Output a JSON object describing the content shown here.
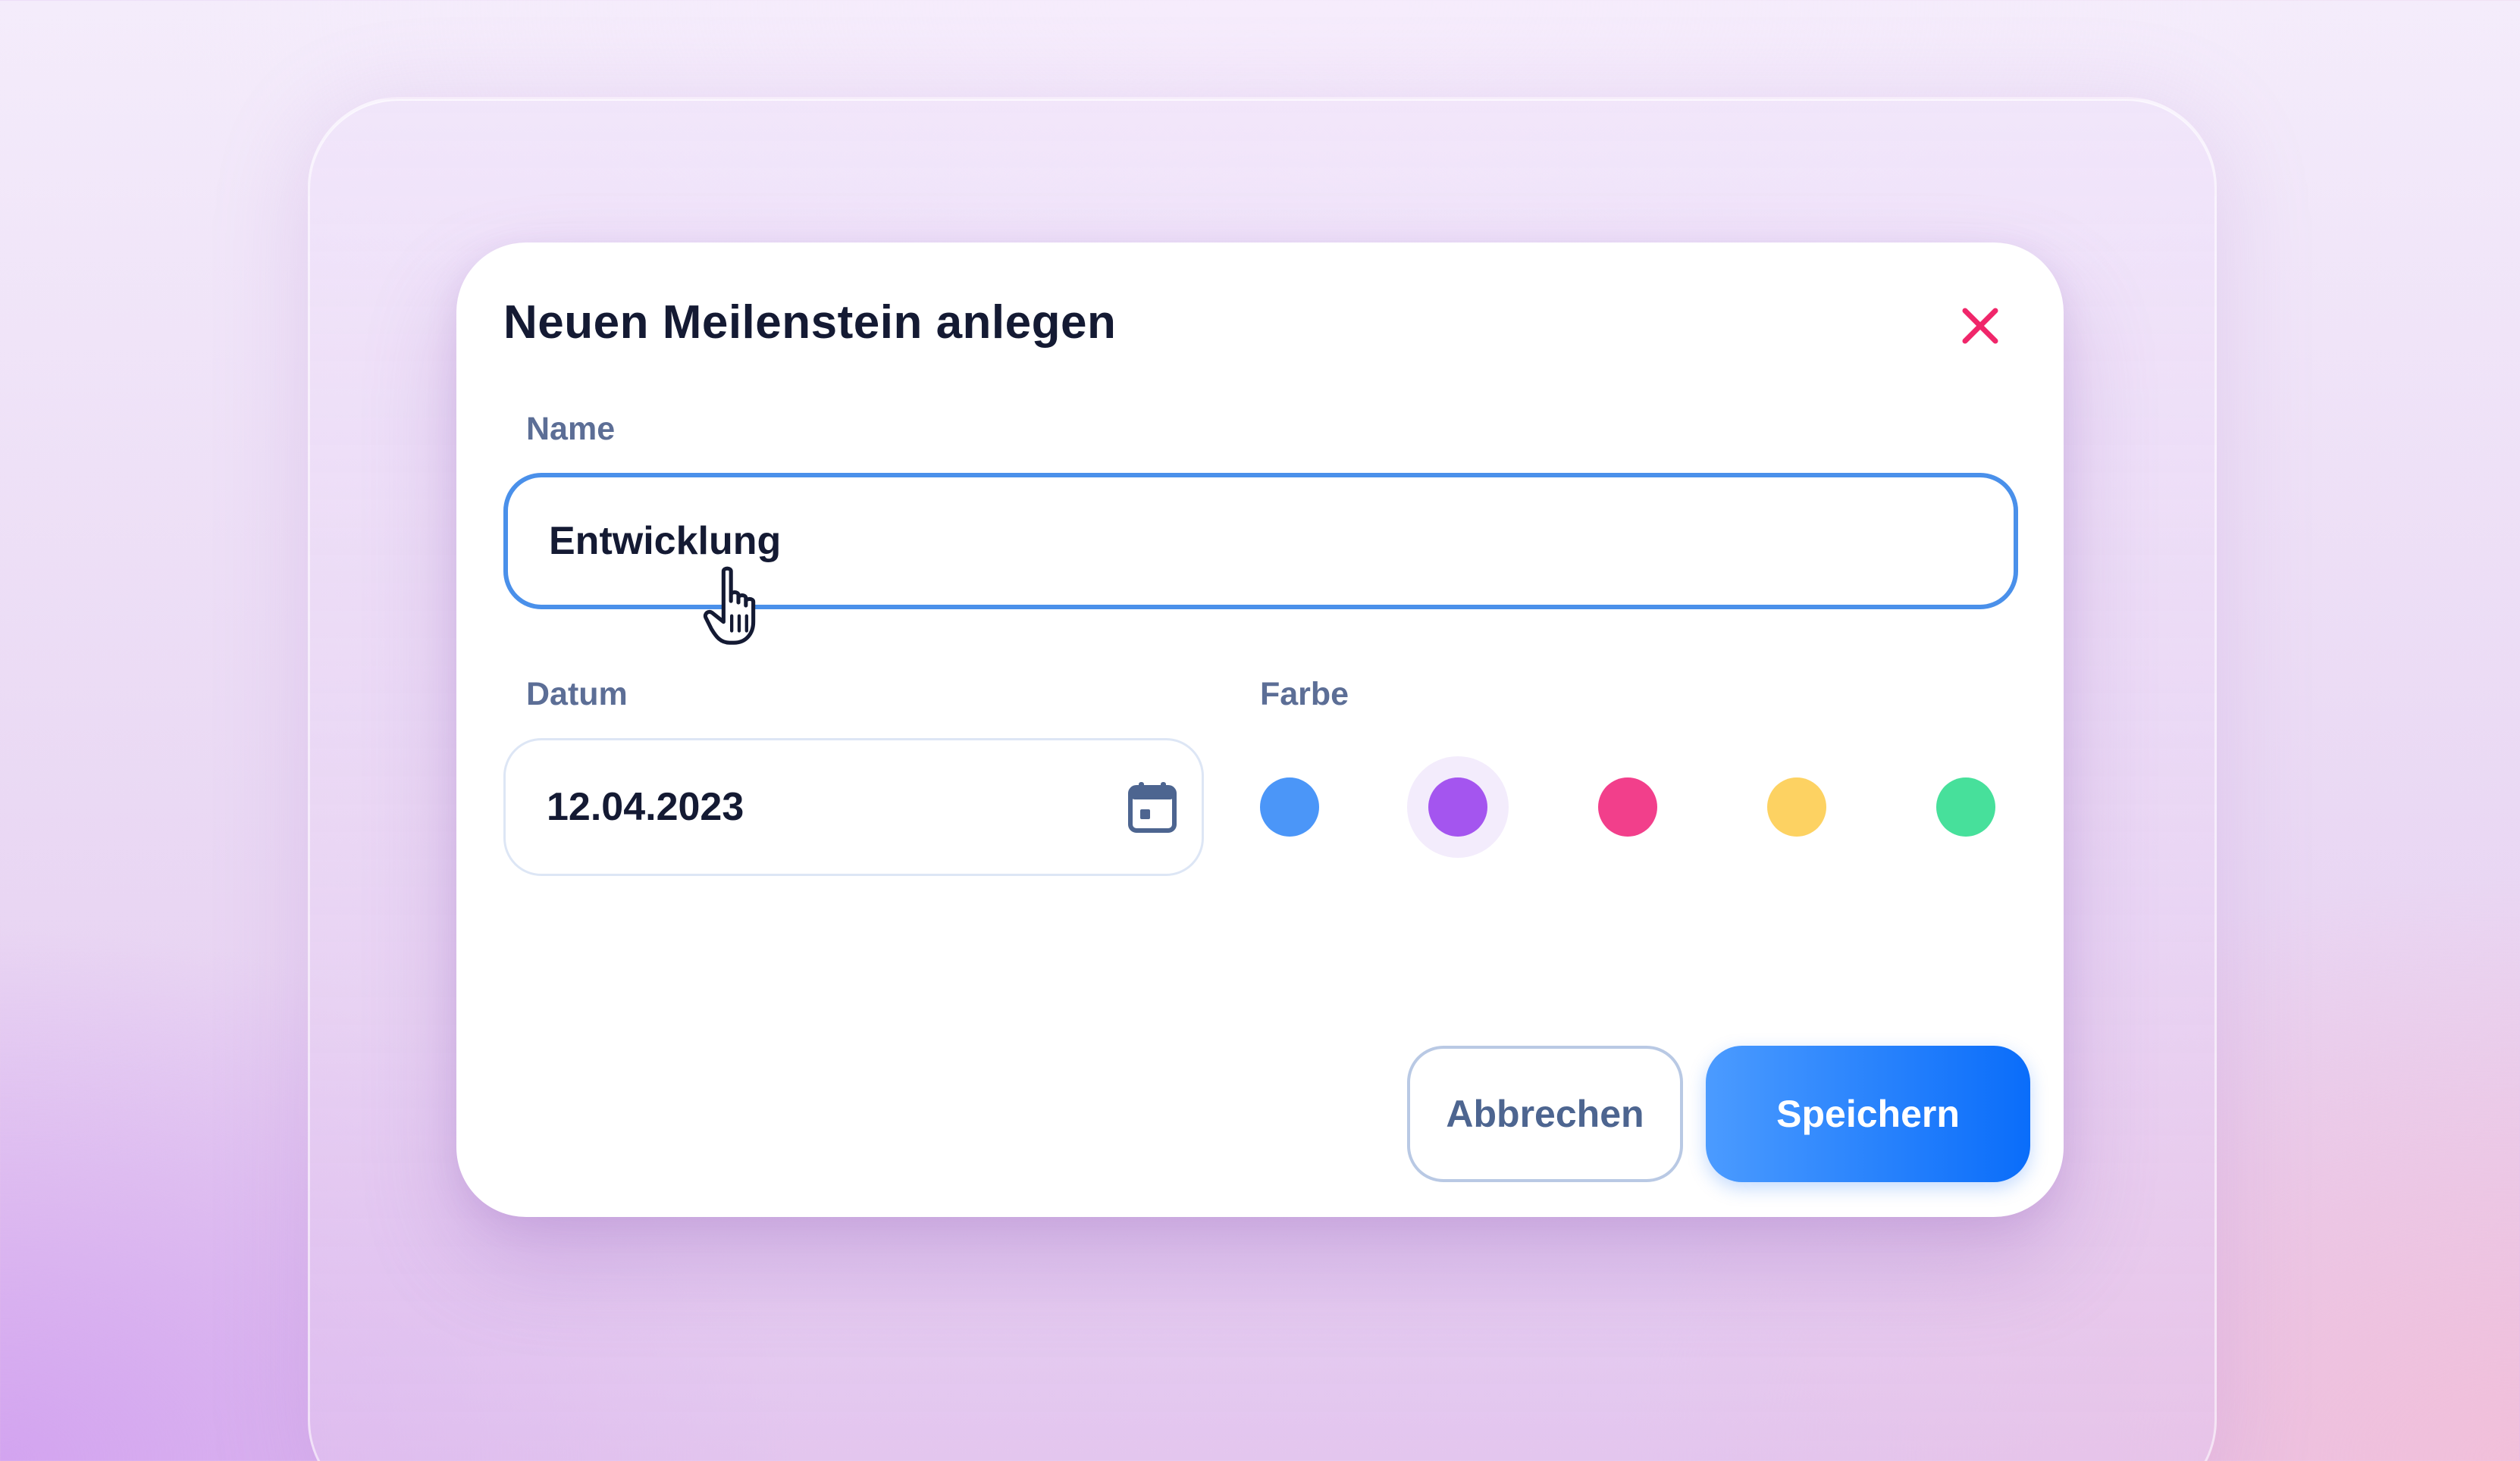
{
  "dialog": {
    "title": "Neuen Meilenstein anlegen",
    "close_icon": "close-icon"
  },
  "form": {
    "name_label": "Name",
    "name_value": "Entwicklung",
    "date_label": "Datum",
    "date_value": "12.04.2023",
    "date_icon": "calendar-icon",
    "color_label": "Farbe",
    "colors": [
      {
        "name": "blue",
        "hex": "#4b96f8"
      },
      {
        "name": "purple",
        "hex": "#a455ef",
        "selected": true
      },
      {
        "name": "pink",
        "hex": "#f23f8b"
      },
      {
        "name": "yellow",
        "hex": "#fdd262"
      },
      {
        "name": "green",
        "hex": "#47e09b"
      }
    ]
  },
  "actions": {
    "cancel_label": "Abbrechen",
    "save_label": "Speichern"
  },
  "theme": {
    "accent": "#0a6dfa",
    "close_color": "#f0266a",
    "title_color": "#141a33",
    "label_color": "#5c6e96"
  },
  "cursor": {
    "icon": "hand-pointer-icon"
  }
}
